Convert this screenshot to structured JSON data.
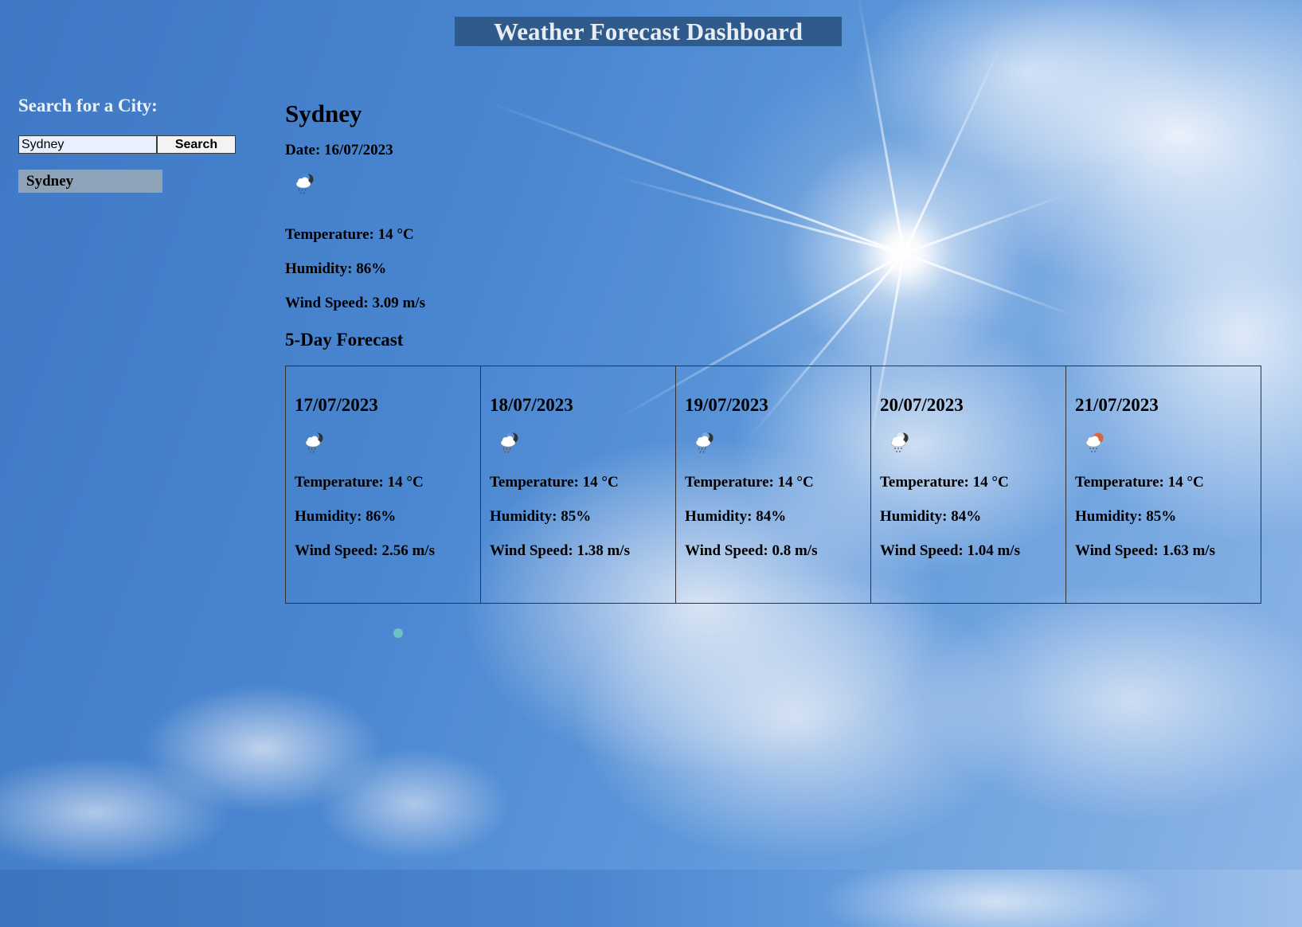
{
  "header": {
    "title": "Weather Forecast Dashboard"
  },
  "sidebar": {
    "search_label": "Search for a City:",
    "search_value": "Sydney",
    "search_button": "Search",
    "history": [
      "Sydney"
    ]
  },
  "current": {
    "city": "Sydney",
    "date": "Date: 16/07/2023",
    "icon": "rain-cloud-moon-icon",
    "temperature": "Temperature: 14 °C",
    "humidity": "Humidity: 86%",
    "wind": "Wind Speed: 3.09 m/s"
  },
  "forecast_title": "5-Day Forecast",
  "forecast": [
    {
      "date": "17/07/2023",
      "icon": "rain-cloud-moon-icon",
      "temperature": "Temperature: 14 °C",
      "humidity": "Humidity: 86%",
      "wind": "Wind Speed: 2.56 m/s"
    },
    {
      "date": "18/07/2023",
      "icon": "rain-cloud-moon-icon",
      "temperature": "Temperature: 14 °C",
      "humidity": "Humidity: 85%",
      "wind": "Wind Speed: 1.38 m/s"
    },
    {
      "date": "19/07/2023",
      "icon": "rain-cloud-moon-icon",
      "temperature": "Temperature: 14 °C",
      "humidity": "Humidity: 84%",
      "wind": "Wind Speed: 0.8 m/s"
    },
    {
      "date": "20/07/2023",
      "icon": "light-rain-moon-icon",
      "temperature": "Temperature: 14 °C",
      "humidity": "Humidity: 84%",
      "wind": "Wind Speed: 1.04 m/s"
    },
    {
      "date": "21/07/2023",
      "icon": "light-rain-sun-icon",
      "temperature": "Temperature: 14 °C",
      "humidity": "Humidity: 85%",
      "wind": "Wind Speed: 1.63 m/s"
    }
  ],
  "colors": {
    "header_bg": "#2f5a8c",
    "history_bg": "#8ea3b8",
    "sun_accent": "#d9653b"
  }
}
